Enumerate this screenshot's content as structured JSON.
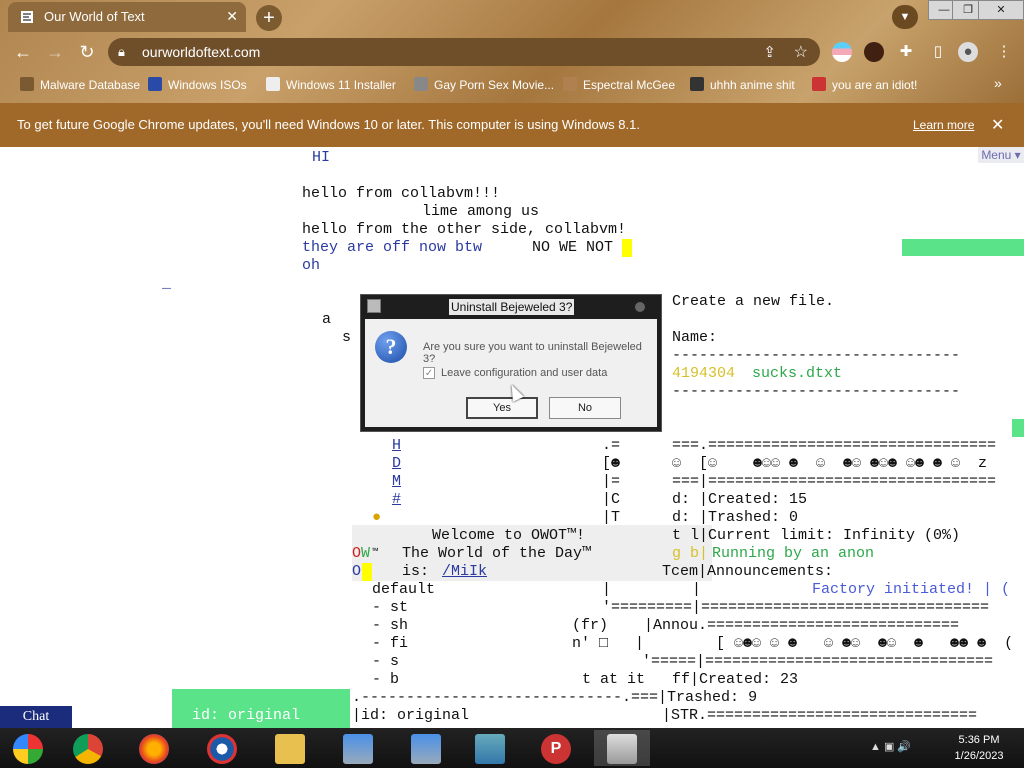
{
  "browser": {
    "tab_title": "Our World of Text",
    "tab_close": "✕",
    "new_tab": "+",
    "url": "ourworldoftext.com",
    "bookmarks": [
      {
        "label": "Malware Database",
        "color": "#7a5a30"
      },
      {
        "label": "Windows ISOs",
        "color": "#2a4aa8"
      },
      {
        "label": "Windows 11 Installer",
        "color": "#eeeeee"
      },
      {
        "label": "Gay Porn Sex Movie...",
        "color": "#888888"
      },
      {
        "label": "Espectral McGee",
        "color": "#b08050"
      },
      {
        "label": "uhhh anime shit",
        "color": "#333333"
      },
      {
        "label": "you are an idiot!",
        "color": "#cc3333"
      }
    ],
    "bookmarks_more": "»",
    "infobar_message": "To get future Google Chrome updates, you'll need Windows 10 or later. This computer is using Windows 8.1.",
    "infobar_link": "Learn more"
  },
  "page": {
    "menu_label": "Menu ▾",
    "lines": {
      "hi": "HI",
      "l1": "hello from collabvm!!!",
      "l2": "lime among us",
      "l3": "hello from the other side, collabvm!",
      "l4_blue": "they are off now btw",
      "l4_black": "NO WE NOT",
      "l5": "oh",
      "dash": "_",
      "a": "a",
      "s": "s",
      "create": "Create a new file.",
      "name": "Name:",
      "sep1": "--------------------------------",
      "file_num": "4194304",
      "file_name": "sucks.dtxt",
      "sep2": "--------------------------------",
      "eq1": ".=",
      "eq1r": "===.================================",
      "smiley_l": "[☻",
      "smiley_mid": "☺  [☺    ☻☺☺ ☻  ☺  ☻☺ ☻☺☻ ☺☻ ☻ ☺  z",
      "eq2": "|=",
      "eq2r": "===|================================",
      "col_c": "|C",
      "d_created": "d: |Created: 15",
      "col_t": "|T",
      "d_trashed": "d: |Trashed: 0",
      "welcome": "Welcome to OWOT™!",
      "t_l": "t l|Current limit: Infinity (0%)",
      "wotd": "The World of the Day™",
      "g_b": "g b|",
      "running": "Running by an anon",
      "is": "is: ",
      "milk": "/MiIk",
      "tcem": "Tcem|Announcements:",
      "default": "default",
      "default_pipes": "|         |",
      "factory": "Factory initiated! | (",
      "st": "- st",
      "st_r": "'=========|================================",
      "sh": "- sh",
      "fr": "(fr)    |Annou.============================",
      "fi": "- fi",
      "fi_r": "n' □   |        [ ☺☻☺ ☺ ☻   ☺ ☻☺  ☻☺  ☻   ☻☻ ☻  (",
      "s2": "- s",
      "s2_r": "'=====|================================",
      "b": "- b",
      "b_r": "t at it   ff|Created: 23",
      "sep3": ".-----------------------------.===|Trashed: 9",
      "id1": "id: original",
      "id2": "|id: original",
      "str": "|STR.==============================",
      "ow_o": "O",
      "ow_w": "W",
      "ow_tm": "™",
      "side_letters": [
        "H",
        "D",
        "M",
        "#"
      ]
    },
    "chat_label": "Chat"
  },
  "dialog": {
    "title": "Uninstall Bejeweled 3?",
    "message": "Are you sure you want to uninstall Bejeweled 3?",
    "checkbox_label": "Leave configuration and user data",
    "checkbox_checked": true,
    "check_mark": "✓",
    "yes_label": "Yes",
    "no_label": "No"
  },
  "taskbar": {
    "time": "5:36 PM",
    "date": "1/26/2023",
    "tray_icons": "▲ ▣ 🔊"
  }
}
